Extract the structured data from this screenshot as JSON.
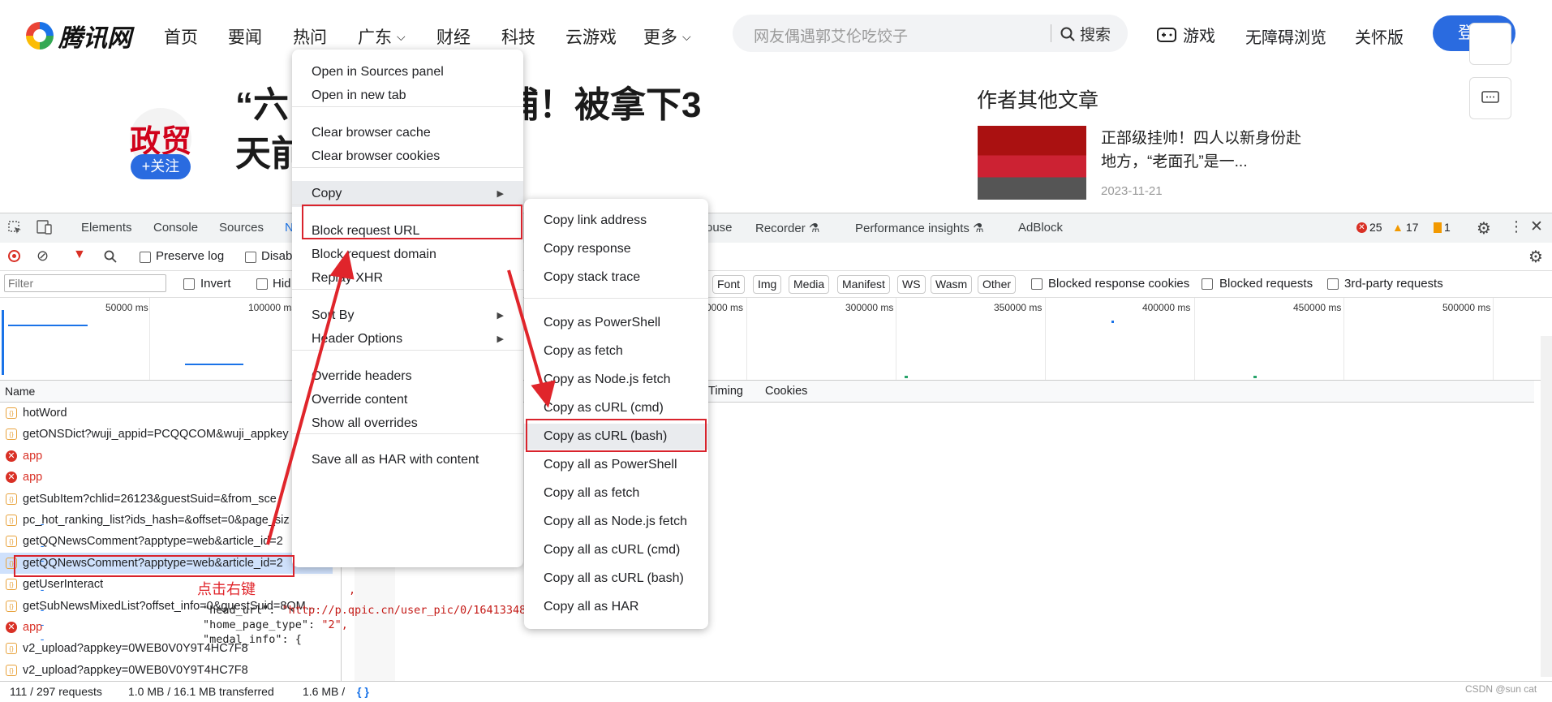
{
  "site": {
    "logo_text": "腾讯网",
    "nav": [
      "首页",
      "要闻",
      "热问",
      "广东",
      "财经",
      "科技",
      "云游戏",
      "更多"
    ],
    "search_placeholder": "网友偶遇郭艾伦吃饺子",
    "search_button": "搜索",
    "games_label": "游戏",
    "accessibility_label": "无障碍浏览",
    "care_label": "关怀版",
    "login_label": "登录",
    "headline_line1": "“六…“老虎”被逮捕！被拿下3",
    "headline_line2": "天前…面",
    "author_name": "政贸",
    "follow_label": "+关注",
    "other_articles_title": "作者其他文章",
    "article_title": "正部级挂帅！四人以新身份赴地方，“老面孔”是一...",
    "article_date": "2023-11-21"
  },
  "devtools": {
    "tabs": [
      "Elements",
      "Console",
      "Sources",
      "N",
      "ouse",
      "Recorder",
      "Performance insights",
      "AdBlock"
    ],
    "errors": "25",
    "warnings": "17",
    "issues": "1",
    "toolbar": {
      "preserve_log": "Preserve log",
      "disable_cache": "Disab"
    },
    "filter": {
      "placeholder": "Filter",
      "invert": "Invert",
      "hide": "Hid",
      "chips": [
        "Font",
        "Img",
        "Media",
        "Manifest",
        "WS",
        "Wasm",
        "Other"
      ],
      "blocked_cookies": "Blocked response cookies",
      "blocked_requests": "Blocked requests",
      "third_party": "3rd-party requests"
    },
    "timeline_labels": [
      "50000 ms",
      "100000 ms",
      "0000 ms",
      "300000 ms",
      "350000 ms",
      "400000 ms",
      "450000 ms",
      "500000 ms"
    ],
    "name_header": "Name",
    "requests": [
      {
        "name": "hotWord",
        "status": "ok"
      },
      {
        "name": "getONSDict?wuji_appid=PCQQCOM&wuji_appkey",
        "status": "ok"
      },
      {
        "name": "app",
        "status": "error"
      },
      {
        "name": "app",
        "status": "error"
      },
      {
        "name": "getSubItem?chlid=26123&guestSuid=&from_sce",
        "status": "ok"
      },
      {
        "name": "pc_hot_ranking_list?ids_hash=&offset=0&page_siz",
        "status": "ok"
      },
      {
        "name": "getQQNewsComment?apptype=web&article_id=2",
        "status": "ok"
      },
      {
        "name": "getQQNewsComment?apptype=web&article_id=2",
        "status": "selected"
      },
      {
        "name": "getUserInteract",
        "status": "ok"
      },
      {
        "name": "getSubNewsMixedList?offset_info=0&guestSuid=8QM...",
        "status": "ok"
      },
      {
        "name": "app",
        "status": "error"
      },
      {
        "name": "v2_upload?appkey=0WEB0V0Y9T4HC7F8",
        "status": "ok"
      },
      {
        "name": "v2_upload?appkey=0WEB0V0Y9T4HC7F8",
        "status": "ok"
      }
    ],
    "annotation": "点击右键",
    "detail_tabs": [
      "Timing",
      "Cookies"
    ],
    "code_lines": [
      {
        "key": "",
        "val": "062OU00\","
      },
      {
        "key": "",
        "val": "\","
      },
      {
        "key": "",
        "val": "\","
      },
      {
        "key": "",
        "val": ","
      },
      {
        "key": "\"head_url\": ",
        "val": "\"http://p.qpic.cn/user_pic/0/1641334878317828865/243\","
      },
      {
        "key": "\"home_page_type\": ",
        "val": "\"2\","
      },
      {
        "key": "\"medal_info\": {",
        "val": ""
      }
    ],
    "status": {
      "requests": "111 / 297 requests",
      "transferred": "1.0 MB / 16.1 MB transferred",
      "resources": "1.6 MB /"
    }
  },
  "context_menu": {
    "items": [
      "Open in Sources panel",
      "Open in new tab",
      "Clear browser cache",
      "Clear browser cookies",
      "Copy",
      "Block request URL",
      "Block request domain",
      "Replay XHR",
      "Sort By",
      "Header Options",
      "Override headers",
      "Override content",
      "Show all overrides",
      "Save all as HAR with content"
    ]
  },
  "copy_submenu": {
    "items": [
      "Copy link address",
      "Copy response",
      "Copy stack trace",
      "Copy as PowerShell",
      "Copy as fetch",
      "Copy as Node.js fetch",
      "Copy as cURL (cmd)",
      "Copy as cURL (bash)",
      "Copy all as PowerShell",
      "Copy all as fetch",
      "Copy all as Node.js fetch",
      "Copy all as cURL (cmd)",
      "Copy all as cURL (bash)",
      "Copy all as HAR"
    ]
  },
  "watermark": "CSDN @sun cat",
  "colors": {
    "accent": "#2a6be0",
    "error": "#d93025",
    "annotation": "#e0252b"
  }
}
